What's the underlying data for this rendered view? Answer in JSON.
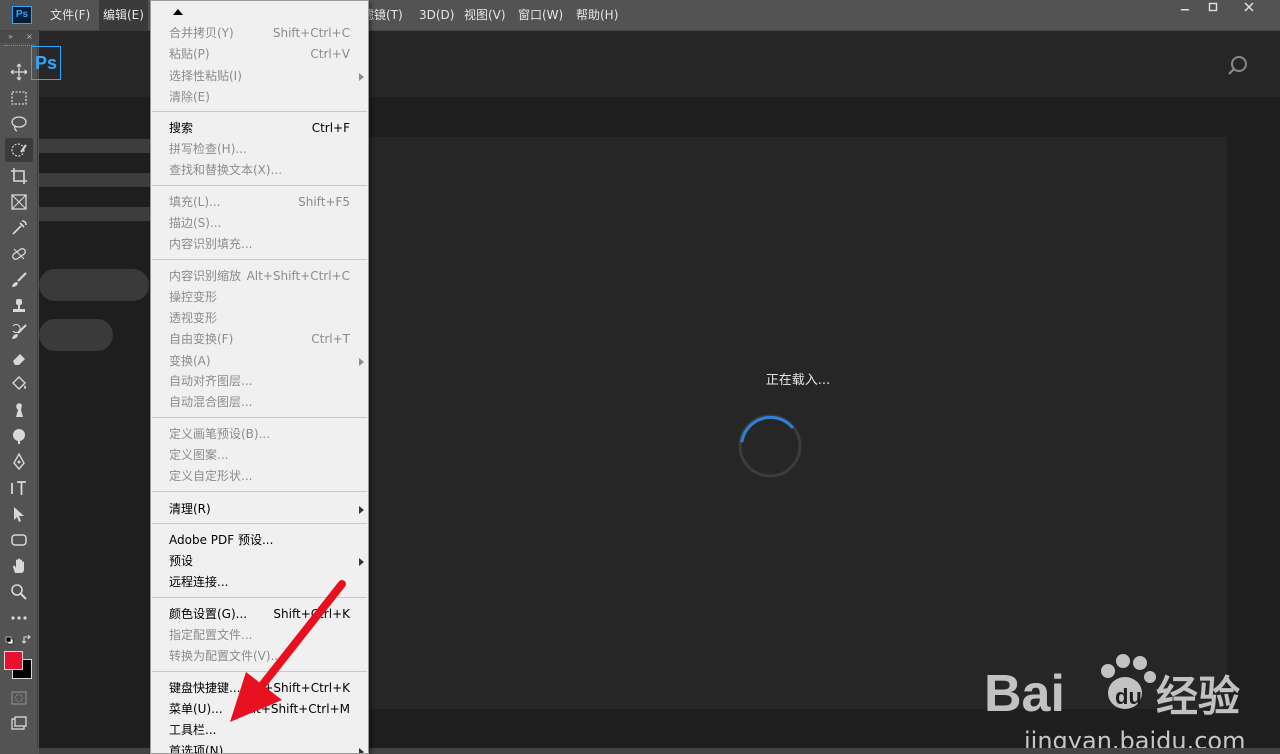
{
  "menubar": {
    "app_icon": "Ps",
    "items": [
      {
        "label": "文件(F)"
      },
      {
        "label": "编辑(E)"
      },
      {
        "label": "滤镜(T)"
      },
      {
        "label": "3D(D)"
      },
      {
        "label": "视图(V)"
      },
      {
        "label": "窗口(W)"
      },
      {
        "label": "帮助(H)"
      }
    ],
    "window_controls": [
      "minimize-icon",
      "maximize-icon",
      "close-icon"
    ]
  },
  "tools": [
    "move-tool-icon",
    "rectangular-marquee-icon",
    "lasso-icon",
    "quick-selection-icon",
    "crop-icon",
    "frame-icon",
    "eyedropper-icon",
    "healing-brush-icon",
    "brush-icon",
    "clone-stamp-icon",
    "history-brush-icon",
    "eraser-icon",
    "paint-bucket-icon",
    "smudge-icon",
    "dodge-icon",
    "pen-icon",
    "type-icon",
    "path-selection-icon",
    "rectangle-shape-icon",
    "hand-icon",
    "zoom-icon",
    "more-tools-icon"
  ],
  "colors": {
    "foreground": "#e8102e",
    "background": "#000000",
    "accent": "#31a8ff"
  },
  "workspace": {
    "logo": "Ps",
    "loading_text": "正在载入...",
    "search_icon": "search-icon"
  },
  "edit_menu": {
    "items": [
      {
        "label": "合并拷贝(Y)",
        "shortcut": "Shift+Ctrl+C",
        "enabled": false
      },
      {
        "label": "粘贴(P)",
        "shortcut": "Ctrl+V",
        "enabled": false
      },
      {
        "label": "选择性粘贴(I)",
        "shortcut": "",
        "enabled": false,
        "submenu": true
      },
      {
        "label": "清除(E)",
        "shortcut": "",
        "enabled": false
      },
      {
        "label": "搜索",
        "shortcut": "Ctrl+F",
        "enabled": true
      },
      {
        "label": "拼写检查(H)...",
        "shortcut": "",
        "enabled": false
      },
      {
        "label": "查找和替换文本(X)...",
        "shortcut": "",
        "enabled": false
      },
      {
        "label": "填充(L)...",
        "shortcut": "Shift+F5",
        "enabled": false
      },
      {
        "label": "描边(S)...",
        "shortcut": "",
        "enabled": false
      },
      {
        "label": "内容识别填充...",
        "shortcut": "",
        "enabled": false
      },
      {
        "label": "内容识别缩放",
        "shortcut": "Alt+Shift+Ctrl+C",
        "enabled": false
      },
      {
        "label": "操控变形",
        "shortcut": "",
        "enabled": false
      },
      {
        "label": "透视变形",
        "shortcut": "",
        "enabled": false
      },
      {
        "label": "自由变换(F)",
        "shortcut": "Ctrl+T",
        "enabled": false
      },
      {
        "label": "变换(A)",
        "shortcut": "",
        "enabled": false,
        "submenu": true
      },
      {
        "label": "自动对齐图层...",
        "shortcut": "",
        "enabled": false
      },
      {
        "label": "自动混合图层...",
        "shortcut": "",
        "enabled": false
      },
      {
        "label": "定义画笔预设(B)...",
        "shortcut": "",
        "enabled": false
      },
      {
        "label": "定义图案...",
        "shortcut": "",
        "enabled": false
      },
      {
        "label": "定义自定形状...",
        "shortcut": "",
        "enabled": false
      },
      {
        "label": "清理(R)",
        "shortcut": "",
        "enabled": true,
        "submenu": true
      },
      {
        "label": "Adobe PDF 预设...",
        "shortcut": "",
        "enabled": true
      },
      {
        "label": "预设",
        "shortcut": "",
        "enabled": true,
        "submenu": true
      },
      {
        "label": "远程连接...",
        "shortcut": "",
        "enabled": true
      },
      {
        "label": "颜色设置(G)...",
        "shortcut": "Shift+Ctrl+K",
        "enabled": true
      },
      {
        "label": "指定配置文件...",
        "shortcut": "",
        "enabled": false
      },
      {
        "label": "转换为配置文件(V)...",
        "shortcut": "",
        "enabled": false
      },
      {
        "label": "键盘快捷键...",
        "shortcut": "Alt+Shift+Ctrl+K",
        "enabled": true
      },
      {
        "label": "菜单(U)...",
        "shortcut": "Alt+Shift+Ctrl+M",
        "enabled": true
      },
      {
        "label": "工具栏...",
        "shortcut": "",
        "enabled": true
      },
      {
        "label": "首选项(N)",
        "shortcut": "",
        "enabled": true,
        "submenu": true
      }
    ]
  },
  "watermark": {
    "brand_prefix": "Bai",
    "brand_suffix": "经验",
    "url": "jingyan.baidu.com"
  }
}
